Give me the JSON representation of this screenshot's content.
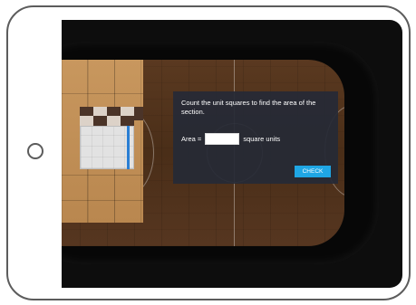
{
  "activity": {
    "prompt": "Count the unit squares to find the area of the section.",
    "area_label": "Area =",
    "area_value": "",
    "unit_label": "square units",
    "check_label": "CHECK"
  },
  "colors": {
    "accent": "#1fa6e4",
    "dialog_bg": "#262a36",
    "court_wood": "#4a2e18",
    "floor_panel": "#c8975e",
    "highlight_bar": "#2a7fd4"
  }
}
